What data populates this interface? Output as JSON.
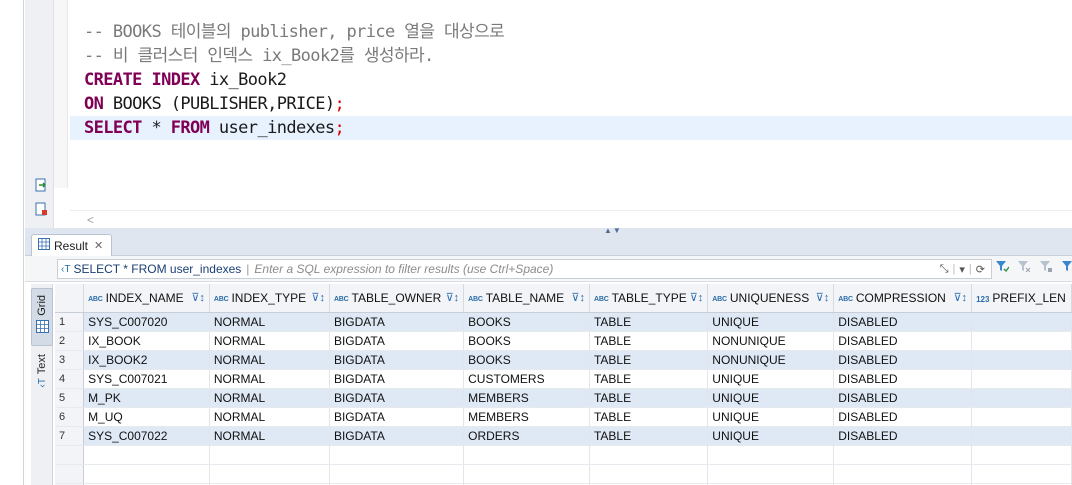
{
  "editor": {
    "lines": [
      {
        "kind": "comment",
        "text": "-- BOOKS 테이블의 publisher, price 열을 대상으로"
      },
      {
        "kind": "comment",
        "text": "-- 비 클러스터 인덱스 ix_Book2를 생성하라."
      },
      {
        "kind": "code",
        "parts": [
          {
            "t": "CREATE INDEX",
            "c": "kw"
          },
          {
            "t": " ix_Book2",
            "c": "tx"
          }
        ]
      },
      {
        "kind": "code",
        "parts": [
          {
            "t": "ON",
            "c": "kw"
          },
          {
            "t": " BOOKS (PUBLISHER,PRICE)",
            "c": "tx"
          },
          {
            "t": ";",
            "c": "semi"
          }
        ]
      },
      {
        "kind": "code",
        "active": true,
        "parts": [
          {
            "t": "SELECT",
            "c": "kw"
          },
          {
            "t": " * ",
            "c": "tx"
          },
          {
            "t": "FROM",
            "c": "kw"
          },
          {
            "t": " user_indexes",
            "c": "tx"
          },
          {
            "t": ";",
            "c": "semi"
          }
        ]
      }
    ]
  },
  "results": {
    "tab_label": "Result",
    "filter": {
      "query": "SELECT * FROM user_indexes",
      "placeholder": "Enter a SQL expression to filter results (use Ctrl+Space)"
    },
    "side_tabs": {
      "grid": "Grid",
      "text": "Text"
    },
    "columns": [
      {
        "label": "INDEX_NAME",
        "type": "ABC"
      },
      {
        "label": "INDEX_TYPE",
        "type": "ABC"
      },
      {
        "label": "TABLE_OWNER",
        "type": "ABC"
      },
      {
        "label": "TABLE_NAME",
        "type": "ABC"
      },
      {
        "label": "TABLE_TYPE",
        "type": "ABC"
      },
      {
        "label": "UNIQUENESS",
        "type": "ABC"
      },
      {
        "label": "COMPRESSION",
        "type": "ABC"
      },
      {
        "label": "PREFIX_LEN",
        "type": "123"
      }
    ],
    "rows": [
      [
        "1",
        "SYS_C007020",
        "NORMAL",
        "BIGDATA",
        "BOOKS",
        "TABLE",
        "UNIQUE",
        "DISABLED",
        ""
      ],
      [
        "2",
        "IX_BOOK",
        "NORMAL",
        "BIGDATA",
        "BOOKS",
        "TABLE",
        "NONUNIQUE",
        "DISABLED",
        ""
      ],
      [
        "3",
        "IX_BOOK2",
        "NORMAL",
        "BIGDATA",
        "BOOKS",
        "TABLE",
        "NONUNIQUE",
        "DISABLED",
        ""
      ],
      [
        "4",
        "SYS_C007021",
        "NORMAL",
        "BIGDATA",
        "CUSTOMERS",
        "TABLE",
        "UNIQUE",
        "DISABLED",
        ""
      ],
      [
        "5",
        "M_PK",
        "NORMAL",
        "BIGDATA",
        "MEMBERS",
        "TABLE",
        "UNIQUE",
        "DISABLED",
        ""
      ],
      [
        "6",
        "M_UQ",
        "NORMAL",
        "BIGDATA",
        "MEMBERS",
        "TABLE",
        "UNIQUE",
        "DISABLED",
        ""
      ],
      [
        "7",
        "SYS_C007022",
        "NORMAL",
        "BIGDATA",
        "ORDERS",
        "TABLE",
        "UNIQUE",
        "DISABLED",
        ""
      ]
    ]
  },
  "colors": {
    "keyword": "#7f0055",
    "comment": "#7a7a7a",
    "semicolon": "#d80000",
    "active_line": "#e8f2fe",
    "row_stripe": "#dfe9f6"
  }
}
